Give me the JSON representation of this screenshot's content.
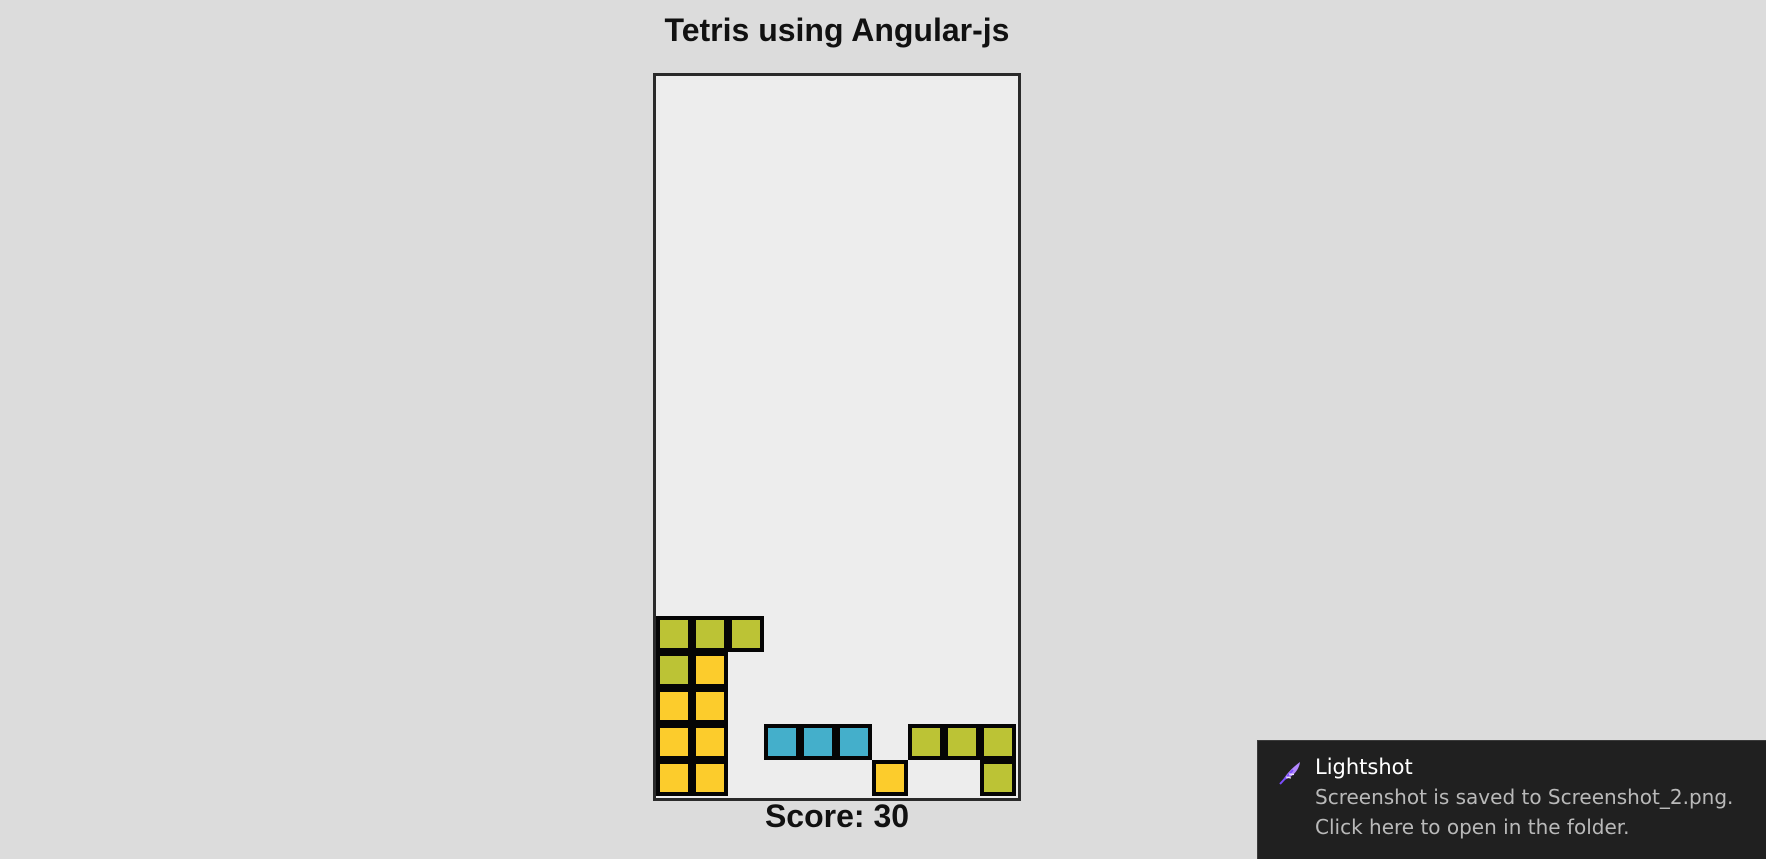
{
  "page": {
    "title": "Tetris using Angular-js"
  },
  "board": {
    "columns": 10,
    "rows": 20,
    "colors": {
      "lime": "#bcc335",
      "yellow": "#fccc2c",
      "cyan": "#44afcb",
      "border": "#050505",
      "background": "#ededed"
    },
    "cells": [
      {
        "col": 0,
        "row": 15,
        "color": "lime"
      },
      {
        "col": 1,
        "row": 15,
        "color": "lime"
      },
      {
        "col": 2,
        "row": 15,
        "color": "lime"
      },
      {
        "col": 0,
        "row": 16,
        "color": "lime"
      },
      {
        "col": 1,
        "row": 16,
        "color": "yellow"
      },
      {
        "col": 0,
        "row": 17,
        "color": "yellow"
      },
      {
        "col": 1,
        "row": 17,
        "color": "yellow"
      },
      {
        "col": 0,
        "row": 18,
        "color": "yellow"
      },
      {
        "col": 1,
        "row": 18,
        "color": "yellow"
      },
      {
        "col": 3,
        "row": 18,
        "color": "cyan"
      },
      {
        "col": 4,
        "row": 18,
        "color": "cyan"
      },
      {
        "col": 5,
        "row": 18,
        "color": "cyan"
      },
      {
        "col": 7,
        "row": 18,
        "color": "lime"
      },
      {
        "col": 8,
        "row": 18,
        "color": "lime"
      },
      {
        "col": 9,
        "row": 18,
        "color": "lime"
      },
      {
        "col": 0,
        "row": 19,
        "color": "yellow"
      },
      {
        "col": 1,
        "row": 19,
        "color": "yellow"
      },
      {
        "col": 6,
        "row": 19,
        "color": "yellow"
      },
      {
        "col": 9,
        "row": 19,
        "color": "lime"
      }
    ]
  },
  "score": {
    "label": "Score: 30",
    "value": 30
  },
  "notification": {
    "icon": "feather-icon",
    "icon_color": "#b388ff",
    "title": "Lightshot",
    "line1": "Screenshot is saved to Screenshot_2.png.",
    "line2": "Click here to open in the folder."
  }
}
